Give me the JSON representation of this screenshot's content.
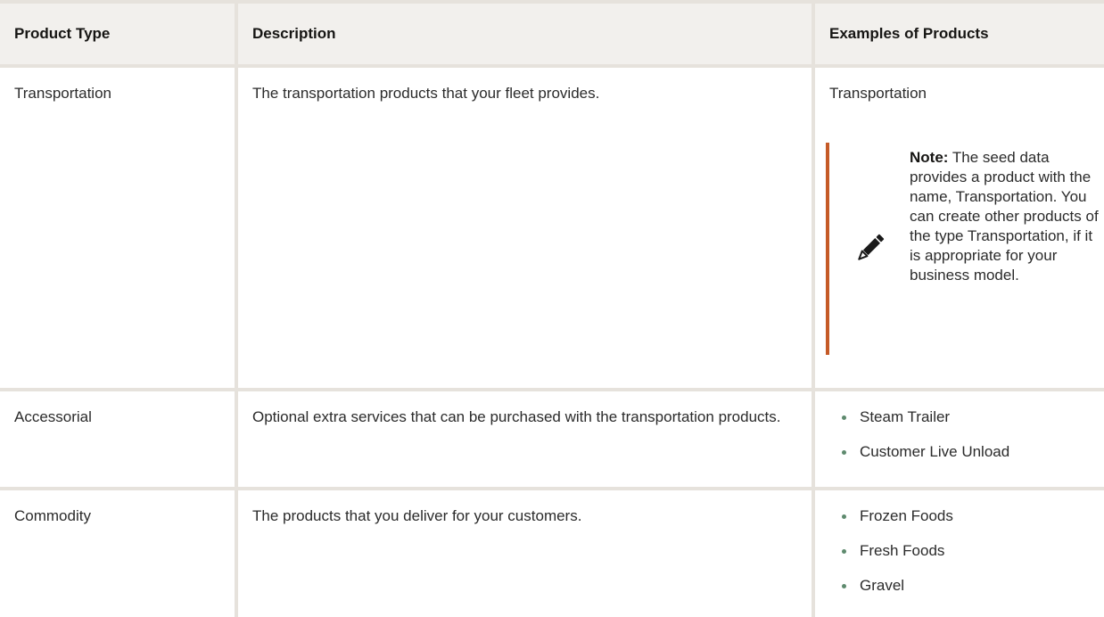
{
  "table": {
    "headers": [
      "Product Type",
      "Description",
      "Examples of Products"
    ],
    "rows": [
      {
        "type": "Transportation",
        "description": "The transportation products that your fleet provides.",
        "example": "Transportation",
        "note": {
          "label": "Note:",
          "text": " The seed data provides a product with the name,  Transportation. You can create other products of the type Transportation, if it is appropriate for your business model.",
          "icon": "pencil-icon"
        }
      },
      {
        "type": "Accessorial",
        "description": "Optional extra services that can be purchased with the transportation products.",
        "examples": [
          "Steam Trailer",
          "Customer Live Unload"
        ]
      },
      {
        "type": "Commodity",
        "description": "The products that you deliver for your customers.",
        "examples": [
          "Frozen Foods",
          "Fresh Foods",
          "Gravel"
        ]
      }
    ]
  },
  "colors": {
    "border": "#e6e2dc",
    "header_bg": "#f2f0ed",
    "note_accent": "#c55a27",
    "bullet": "#5e8a6e"
  }
}
